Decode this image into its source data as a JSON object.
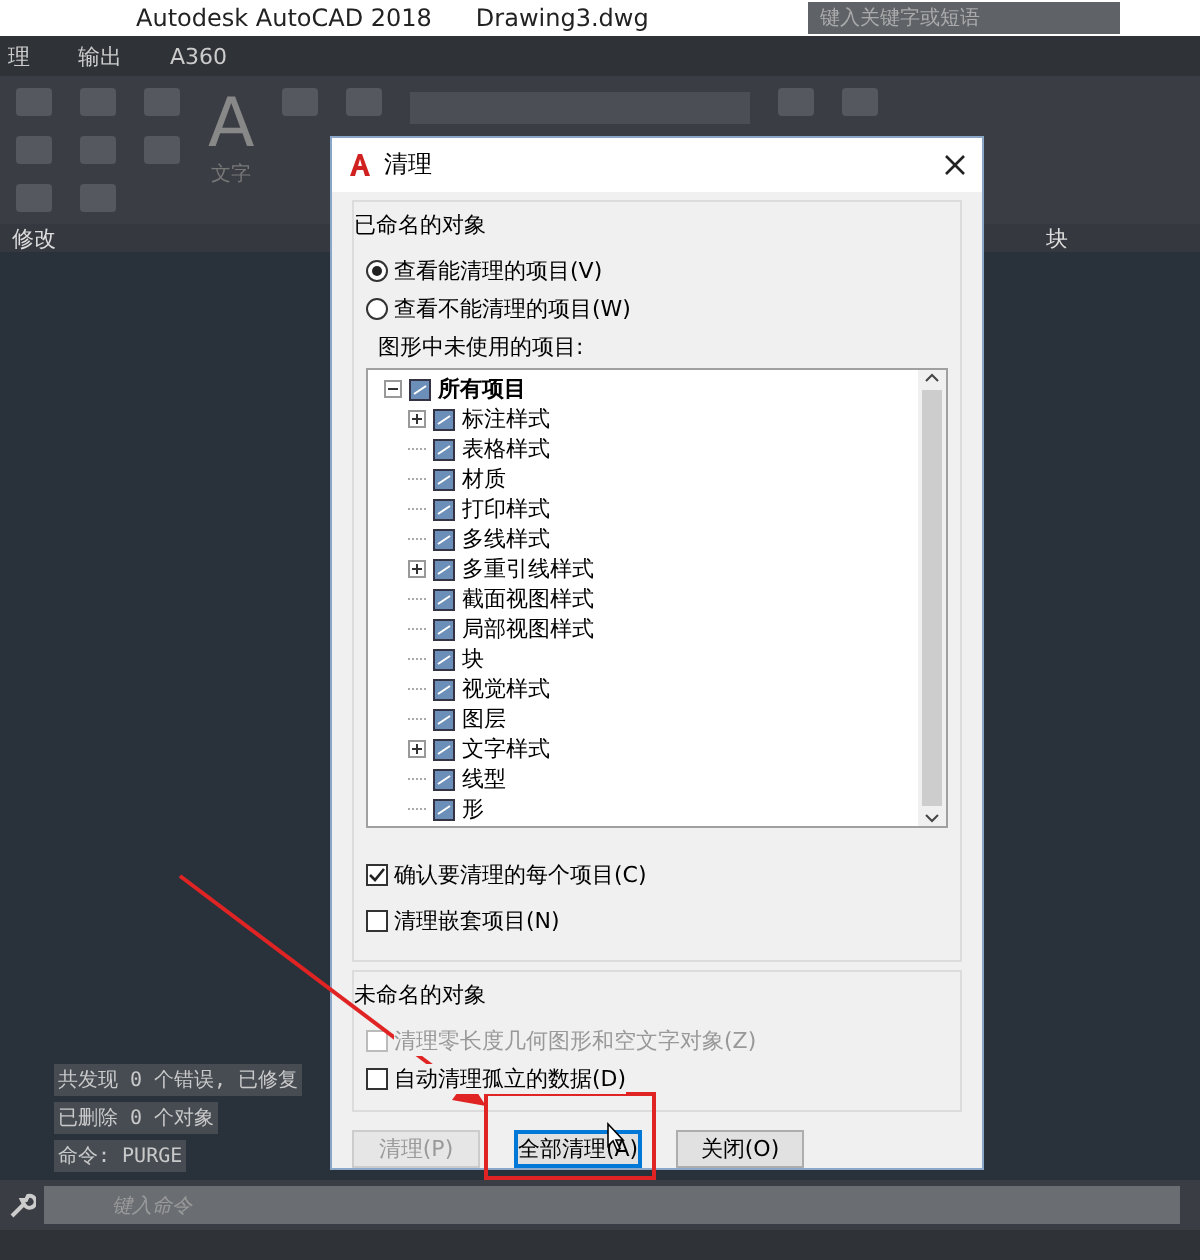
{
  "title_bar": {
    "app": "Autodesk AutoCAD 2018",
    "file": "Drawing3.dwg",
    "search_placeholder": "键入关键字或短语"
  },
  "ribbon_tabs": [
    {
      "label": "理",
      "selected": false
    },
    {
      "label": "输出",
      "selected": false
    },
    {
      "label": "A360",
      "selected": false
    }
  ],
  "ribbon": {
    "text_tool": {
      "glyph": "A",
      "label": "文字"
    },
    "panels": [
      {
        "label": "修改"
      },
      {
        "label": "块"
      }
    ]
  },
  "dialog": {
    "title": "清理",
    "named_group": {
      "title": "已命名的对象",
      "options": [
        {
          "label": "查看能清理的项目(V)",
          "selected": true
        },
        {
          "label": "查看不能清理的项目(W)",
          "selected": false
        }
      ],
      "tree_label": "图形中未使用的项目:",
      "tree": [
        {
          "label": "所有项目",
          "expanded": true,
          "children": [
            {
              "label": "标注样式",
              "expanded": false,
              "expandable": true
            },
            {
              "label": "表格样式",
              "expandable": false
            },
            {
              "label": "材质",
              "expandable": false
            },
            {
              "label": "打印样式",
              "expandable": false
            },
            {
              "label": "多线样式",
              "expandable": false
            },
            {
              "label": "多重引线样式",
              "expanded": false,
              "expandable": true
            },
            {
              "label": "截面视图样式",
              "expandable": false
            },
            {
              "label": "局部视图样式",
              "expandable": false
            },
            {
              "label": "块",
              "expandable": false
            },
            {
              "label": "视觉样式",
              "expandable": false
            },
            {
              "label": "图层",
              "expandable": false
            },
            {
              "label": "文字样式",
              "expanded": false,
              "expandable": true
            },
            {
              "label": "线型",
              "expandable": false
            },
            {
              "label": "形",
              "expandable": false
            }
          ]
        }
      ],
      "checkboxes": [
        {
          "label": "确认要清理的每个项目(C)",
          "checked": true
        },
        {
          "label": "清理嵌套项目(N)",
          "checked": false
        }
      ]
    },
    "unnamed_group": {
      "title": "未命名的对象",
      "checkboxes": [
        {
          "label": "清理零长度几何图形和空文字对象(Z)",
          "checked": false,
          "disabled": true
        },
        {
          "label": "自动清理孤立的数据(D)",
          "checked": false,
          "disabled": false
        }
      ]
    },
    "buttons": [
      {
        "label": "清理(P)",
        "disabled": true,
        "focused": false
      },
      {
        "label": "全部清理(A)",
        "disabled": false,
        "focused": true
      },
      {
        "label": "关闭(O)",
        "disabled": false,
        "focused": false
      }
    ]
  },
  "command_history": [
    "共发现 0 个错误, 已修复",
    "已删除 0 个对象",
    "命令: PURGE"
  ],
  "command_line": {
    "placeholder": "键入命令"
  }
}
